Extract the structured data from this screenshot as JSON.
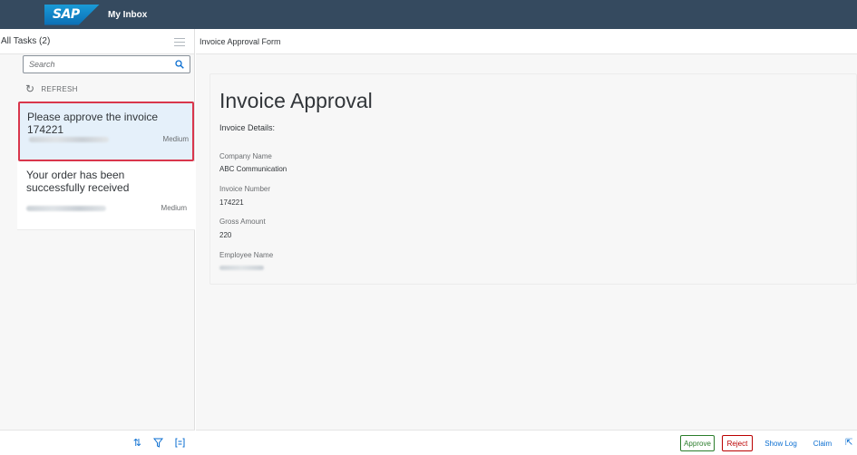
{
  "shell": {
    "logo": "SAP",
    "title": "My Inbox"
  },
  "master": {
    "header": "All Tasks (2)",
    "search_placeholder": "Search",
    "refresh_label": "REFRESH",
    "items": [
      {
        "title": "Please approve the invoice 174221",
        "priority": "Medium",
        "selected": true
      },
      {
        "title": "Your order has been successfully received",
        "priority": "Medium",
        "selected": false
      }
    ],
    "footer_icons": [
      "sort-icon",
      "filter-icon",
      "group-icon"
    ]
  },
  "detail": {
    "header": "Invoice Approval Form",
    "form_title": "Invoice Approval",
    "section_title": "Invoice Details:",
    "fields": [
      {
        "label": "Company Name",
        "value": "ABC Communication"
      },
      {
        "label": "Invoice Number",
        "value": "174221"
      },
      {
        "label": "Gross Amount",
        "value": "220"
      },
      {
        "label": "Employee Name",
        "value": ""
      }
    ],
    "actions": {
      "approve": "Approve",
      "reject": "Reject",
      "show_log": "Show Log",
      "claim": "Claim"
    }
  },
  "colors": {
    "shell": "#354a5f",
    "accent": "#0a6ed1",
    "selected_border": "#d9364c",
    "approve": "#2b7d2b",
    "reject": "#bb0000"
  }
}
